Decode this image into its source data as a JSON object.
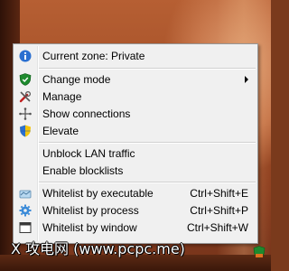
{
  "menu": {
    "items": [
      {
        "label": "Current zone: Private",
        "icon": "info-icon"
      },
      {
        "label": "Change mode",
        "icon": "shield-icon",
        "submenu": true
      },
      {
        "label": "Manage",
        "icon": "tools-icon"
      },
      {
        "label": "Show connections",
        "icon": "network-icon"
      },
      {
        "label": "Elevate",
        "icon": "uac-shield-icon"
      },
      {
        "label": "Unblock LAN traffic"
      },
      {
        "label": "Enable blocklists"
      },
      {
        "label": "Whitelist by executable",
        "shortcut": "Ctrl+Shift+E",
        "icon": "executable-icon"
      },
      {
        "label": "Whitelist by process",
        "shortcut": "Ctrl+Shift+P",
        "icon": "gear-icon"
      },
      {
        "label": "Whitelist by window",
        "shortcut": "Ctrl+Shift+W",
        "icon": "window-icon"
      }
    ]
  },
  "watermark": {
    "text": "X 攻电网 (www.pcpc.me)"
  }
}
